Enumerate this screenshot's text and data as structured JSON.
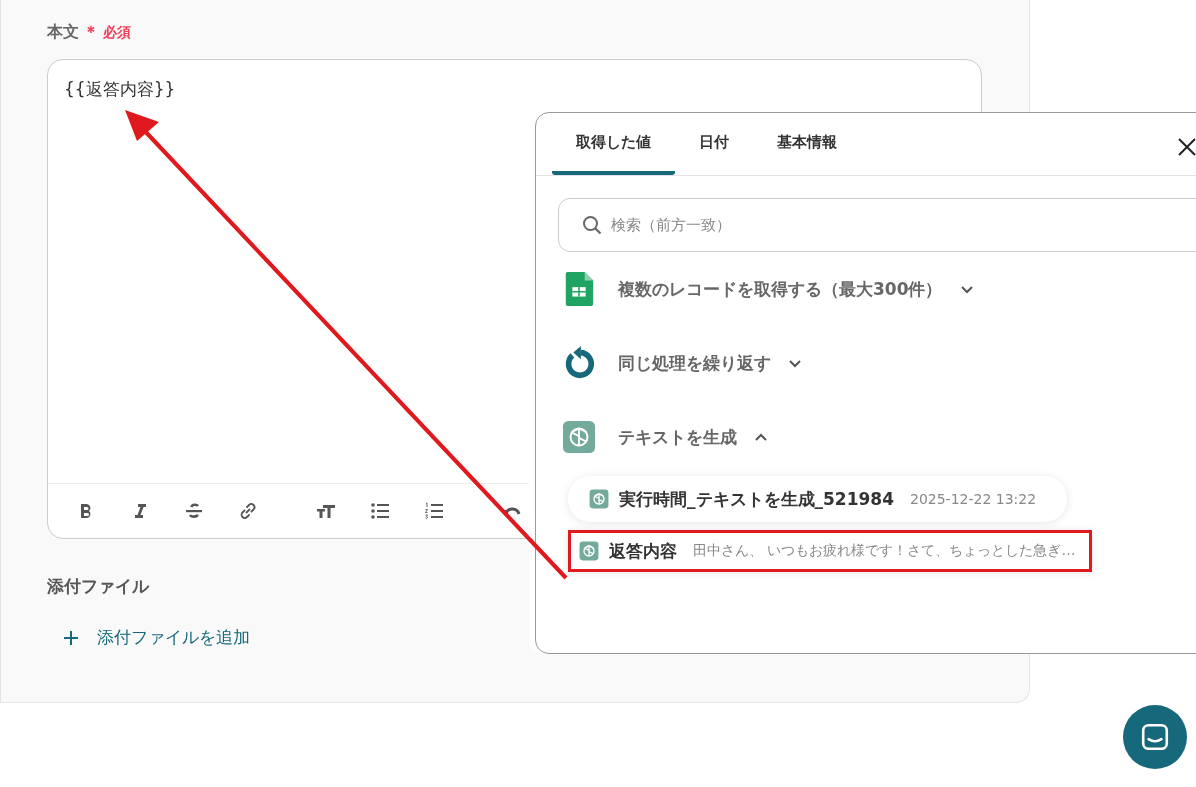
{
  "field": {
    "label": "本文",
    "required_mark": "＊",
    "required_text": "必須",
    "value": "{{返答内容}}"
  },
  "toolbar": [
    {
      "kind": "bold"
    },
    {
      "kind": "italic"
    },
    {
      "kind": "strike"
    },
    {
      "kind": "link"
    },
    {
      "kind": "textsize"
    },
    {
      "kind": "bullets"
    },
    {
      "kind": "numbers"
    },
    {
      "kind": "undo"
    }
  ],
  "attachments": {
    "label": "添付ファイル",
    "add_link": "添付ファイルを追加"
  },
  "picker": {
    "tabs": [
      {
        "label": "取得した値",
        "selected": true
      },
      {
        "label": "日付",
        "selected": false
      },
      {
        "label": "基本情報",
        "selected": false
      }
    ],
    "search": {
      "placeholder": "検索（前方一致）"
    },
    "groups": [
      {
        "title": "複数のレコードを取得する（最大300件）",
        "expanded": false
      },
      {
        "title": "同じ処理を繰り返す",
        "expanded": false
      },
      {
        "title": "テキストを生成",
        "expanded": true,
        "items": [
          {
            "name": "実行時間_テキストを生成_521984",
            "value": "2025-12-22 13:22",
            "highlighted": false
          },
          {
            "name": "返答内容",
            "value": "田中さん、 いつもお疲れ様です！さて、ちょっとした急ぎ…",
            "highlighted": true
          }
        ]
      }
    ]
  }
}
